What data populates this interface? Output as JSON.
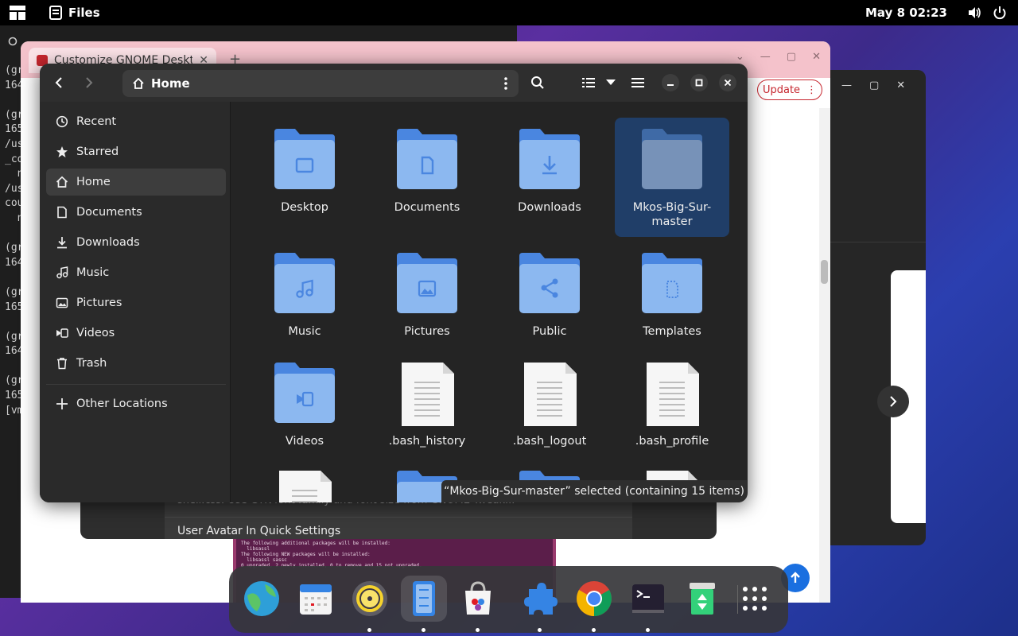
{
  "topbar": {
    "app_name": "Files",
    "clock": "May 8  02:23"
  },
  "terminal": {
    "lines": [
      "(gr",
      "164",
      "",
      "(gr",
      "165",
      "/us",
      "_co",
      "  n",
      "/us",
      "cou",
      "  n",
      "",
      "(gr",
      "164",
      "",
      "(gr",
      "165",
      "",
      "(gr",
      "164",
      "",
      "(gr",
      "165",
      "[vm"
    ]
  },
  "browser": {
    "tab_title": "Customize GNOME Desktop",
    "update_label": "Update",
    "terminal_snippet": "The following additional packages will be installed:\n  libsassl\nThe following NEW packages will be installed:\n  libsassl sassc\n0 upgraded, 2 newly installed, 0 to remove and 15 not upgraded."
  },
  "settings_panel": {
    "line1": "shell.css. Use GTK font family and font size from GNOME Tweak...",
    "line2": "User Avatar In Quick Settings"
  },
  "files": {
    "path": "Home",
    "sidebar": [
      {
        "label": "Recent",
        "icon": "clock-icon"
      },
      {
        "label": "Starred",
        "icon": "star-icon"
      },
      {
        "label": "Home",
        "icon": "home-icon",
        "active": true
      },
      {
        "label": "Documents",
        "icon": "document-icon"
      },
      {
        "label": "Downloads",
        "icon": "download-icon"
      },
      {
        "label": "Music",
        "icon": "music-icon"
      },
      {
        "label": "Pictures",
        "icon": "picture-icon"
      },
      {
        "label": "Videos",
        "icon": "video-icon"
      },
      {
        "label": "Trash",
        "icon": "trash-icon"
      }
    ],
    "other_locations": "Other Locations",
    "items": [
      {
        "name": "Desktop",
        "kind": "folder",
        "emblem": "desktop"
      },
      {
        "name": "Documents",
        "kind": "folder",
        "emblem": "document"
      },
      {
        "name": "Downloads",
        "kind": "folder",
        "emblem": "download"
      },
      {
        "name": "Mkos-Big-Sur-master",
        "kind": "folder",
        "emblem": "none",
        "selected": true
      },
      {
        "name": "Music",
        "kind": "folder",
        "emblem": "music"
      },
      {
        "name": "Pictures",
        "kind": "folder",
        "emblem": "picture"
      },
      {
        "name": "Public",
        "kind": "folder",
        "emblem": "share"
      },
      {
        "name": "Templates",
        "kind": "folder",
        "emblem": "template"
      },
      {
        "name": "Videos",
        "kind": "folder",
        "emblem": "video"
      },
      {
        "name": ".bash_history",
        "kind": "file"
      },
      {
        "name": ".bash_logout",
        "kind": "file"
      },
      {
        "name": ".bash_profile",
        "kind": "file"
      }
    ],
    "status": "“Mkos-Big-Sur-master” selected  (containing 15 items)"
  },
  "dock": {
    "apps": [
      "web-browser",
      "calendar",
      "rhythmbox",
      "files",
      "software-store",
      "extensions",
      "chrome",
      "terminal",
      "recycle-bin",
      "app-grid"
    ]
  },
  "colors": {
    "folder_body": "#8cb8f0",
    "folder_tab": "#4a86e0",
    "selection": "#203e68",
    "accent_red": "#c6262e"
  }
}
